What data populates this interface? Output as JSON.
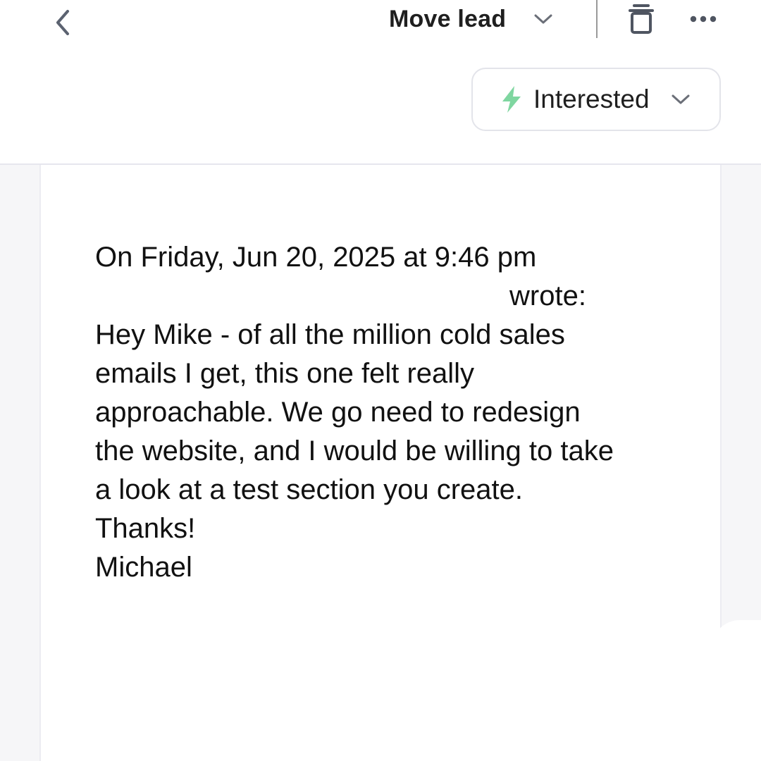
{
  "toolbar": {
    "move_lead_label": "Move lead"
  },
  "status": {
    "label": "Interested",
    "icon": "lightning-bolt-icon",
    "icon_color": "#7fd6a0"
  },
  "email": {
    "header_line": "On Friday, Jun 20, 2025 at 9:46 pm",
    "wrote_line": "wrote:",
    "body_lines": [
      "Hey Mike - of all the million cold sales",
      "emails I get, this one felt really",
      "approachable. We go need to redesign",
      "the website, and I would be willing to take",
      "a look at a test section you create."
    ],
    "closing": "Thanks!",
    "signature": "Michael"
  }
}
